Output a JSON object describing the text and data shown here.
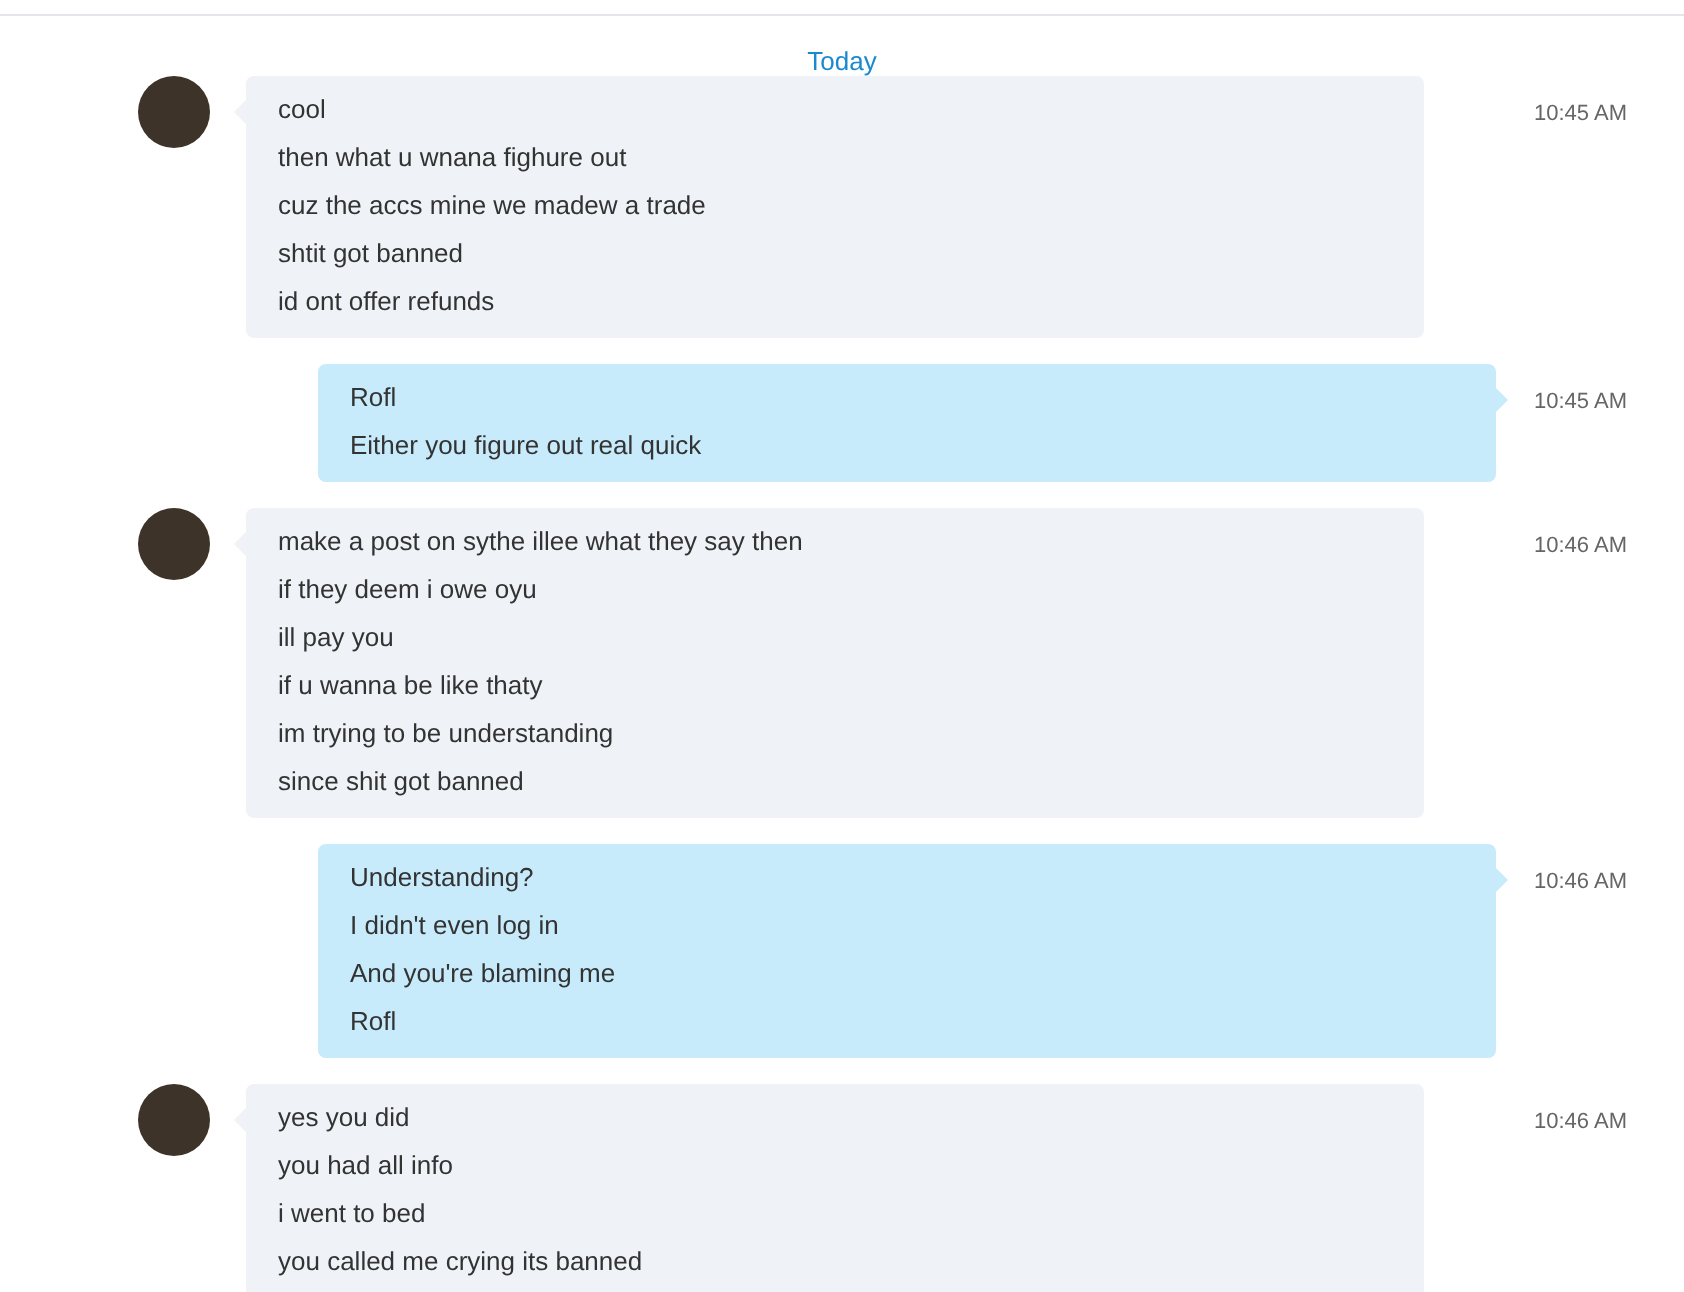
{
  "date_divider": "Today",
  "messages": [
    {
      "kind": "incoming",
      "time": "10:45 AM",
      "lines": [
        "cool",
        "then what u wnana fighure out",
        "cuz the accs mine we madew a trade",
        "shtit got banned",
        "id ont offer refunds"
      ]
    },
    {
      "kind": "outgoing",
      "time": "10:45 AM",
      "lines": [
        "Rofl",
        "Either you figure out real quick"
      ]
    },
    {
      "kind": "incoming",
      "time": "10:46 AM",
      "lines": [
        "make a post on sythe illee what they say then",
        "if they deem i owe oyu",
        "ill pay you",
        "if u wanna be like thaty",
        "im trying to be understanding",
        "since shit got banned"
      ]
    },
    {
      "kind": "outgoing",
      "time": "10:46 AM",
      "lines": [
        "Understanding?",
        "I didn't even log in",
        "And you're blaming me",
        "Rofl"
      ]
    },
    {
      "kind": "incoming",
      "time": "10:46 AM",
      "lines": [
        "yes you did",
        "you had all info",
        "i went to bed",
        "you called me crying its banned"
      ]
    }
  ]
}
